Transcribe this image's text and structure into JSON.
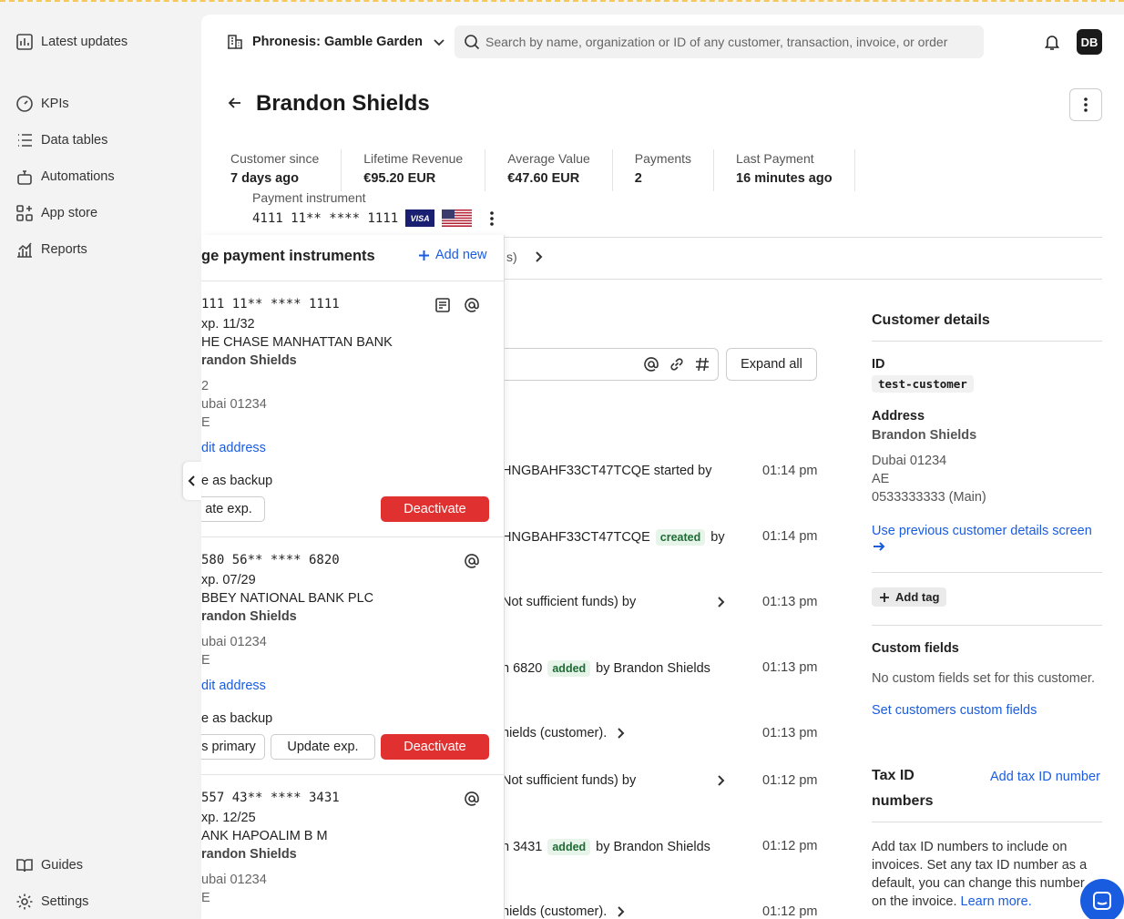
{
  "sidebar": {
    "items": [
      {
        "label": "Latest updates",
        "icon": "chart-bar-icon"
      },
      {
        "label": "KPIs",
        "icon": "gauge-icon"
      },
      {
        "label": "Data tables",
        "icon": "list-icon"
      },
      {
        "label": "Automations",
        "icon": "robot-icon"
      },
      {
        "label": "App store",
        "icon": "apps-icon"
      },
      {
        "label": "Reports",
        "icon": "reports-icon"
      }
    ],
    "bottom": [
      {
        "label": "Guides",
        "icon": "book-icon"
      },
      {
        "label": "Settings",
        "icon": "gear-icon"
      }
    ]
  },
  "header": {
    "org": "Phronesis: Gamble Garden",
    "search_placeholder": "Search by name, organization or ID of any customer, transaction, invoice, or order",
    "avatar": "DB"
  },
  "customer": {
    "name": "Brandon Shields",
    "stats": [
      {
        "label": "Customer since",
        "value": "7 days ago"
      },
      {
        "label": "Lifetime Revenue",
        "value": "€95.20 EUR"
      },
      {
        "label": "Average Value",
        "value": "€47.60 EUR"
      },
      {
        "label": "Payments",
        "value": "2"
      },
      {
        "label": "Last Payment",
        "value": "16 minutes ago"
      }
    ],
    "payment_instrument_label": "Payment instrument",
    "payment_instrument_number": "4111 11** **** 1111",
    "visa_label": "VISA"
  },
  "tabs_fragment": "s)",
  "timeline": {
    "expand_label": "Expand all",
    "rows": [
      {
        "text": "HNGBAHF33CT47TCQE started by",
        "badge": "",
        "after": "",
        "chevron": false,
        "time": "01:14 pm"
      },
      {
        "text": "HNGBAHF33CT47TCQE",
        "badge": "created",
        "after": "by",
        "chevron": false,
        "time": "01:14 pm"
      },
      {
        "text": "Not sufficient funds) by",
        "badge": "",
        "after": "",
        "chevron": true,
        "time": "01:13 pm"
      },
      {
        "text": "n 6820",
        "badge": "added",
        "after": "by Brandon Shields",
        "chevron": false,
        "time": "01:13 pm"
      },
      {
        "text": "hields (customer).",
        "badge": "",
        "after": "",
        "chevron": true,
        "time": "01:13 pm"
      },
      {
        "text": "Not sufficient funds) by",
        "badge": "",
        "after": "",
        "chevron": true,
        "time": "01:12 pm"
      },
      {
        "text": "n 3431",
        "badge": "added",
        "after": "by Brandon Shields",
        "chevron": false,
        "time": "01:12 pm"
      },
      {
        "text": "hields (customer).",
        "badge": "",
        "after": "",
        "chevron": true,
        "time": "01:12 pm"
      }
    ]
  },
  "details": {
    "title": "Customer details",
    "id_label": "ID",
    "id_value": "test-customer",
    "address_label": "Address",
    "address_name": "Brandon Shields",
    "address_city": "Dubai 01234",
    "address_country": "AE",
    "address_phone": "0533333333 (Main)",
    "prev_screen_link": "Use previous customer details screen",
    "add_tag": "Add tag",
    "custom_fields_label": "Custom fields",
    "custom_fields_empty": "No custom fields set for this customer.",
    "custom_fields_link": "Set customers custom fields",
    "tax_title": "Tax ID numbers",
    "tax_add_link": "Add tax ID number",
    "tax_desc": "Add tax ID numbers to include on invoices. Set any tax ID number as a default, you can change this number on the invoice.",
    "tax_learn_more": "Learn more."
  },
  "panel": {
    "title": "ge payment instruments",
    "add_new": "Add new",
    "cards": [
      {
        "number": "111 11** **** 1111",
        "exp": "xp. 11/32",
        "bank": "HE CHASE MANHATTAN BANK",
        "holder": "randon Shields",
        "line1": "2",
        "city": "ubai 01234",
        "country": "E",
        "edit": "dit address",
        "backup": "e as backup",
        "btn_primary": "",
        "btn_update": "ate exp.",
        "btn_deactivate": "Deactivate"
      },
      {
        "number": "580 56** **** 6820",
        "exp": "xp. 07/29",
        "bank": "BBEY NATIONAL BANK PLC",
        "holder": "randon Shields",
        "line1": "",
        "city": "ubai 01234",
        "country": "E",
        "edit": "dit address",
        "backup": "e as backup",
        "btn_primary": "s primary",
        "btn_update": "Update exp.",
        "btn_deactivate": "Deactivate"
      },
      {
        "number": "557 43** **** 3431",
        "exp": "xp. 12/25",
        "bank": "ANK HAPOALIM B M",
        "holder": "randon Shields",
        "line1": "",
        "city": "ubai 01234",
        "country": "E"
      }
    ]
  },
  "colors": {
    "accent": "#1a5ce0",
    "danger": "#e03030",
    "badge_bg": "#e6f4ea"
  }
}
